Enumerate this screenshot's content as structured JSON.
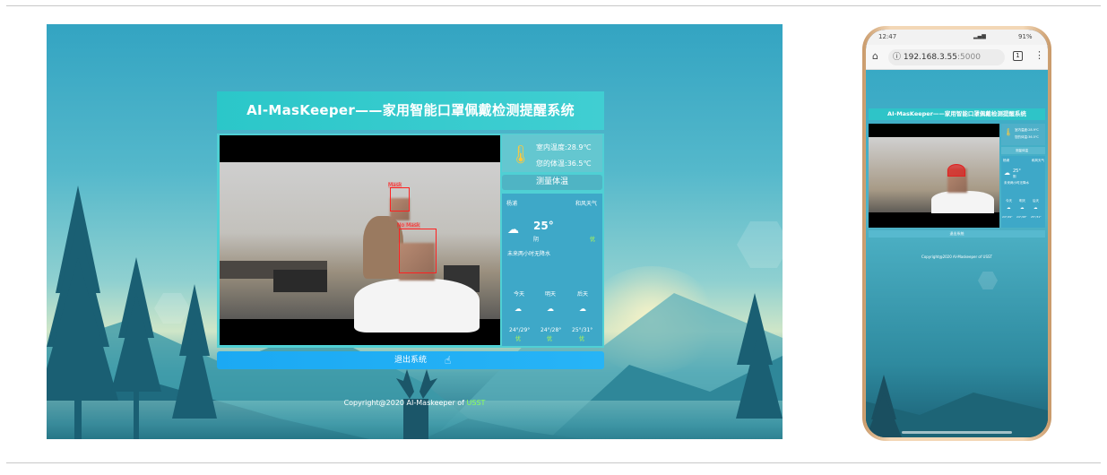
{
  "desktop": {
    "title": "AI-MasKeeper——家用智能口罩佩戴检测提醒系统",
    "temperature": {
      "indoor": "室内温度:28.9℃",
      "body": "您的体温:36.5℃",
      "measure_button": "测量体温"
    },
    "detection_labels": [
      "Mask",
      "No Mask"
    ],
    "weather": {
      "city": "杨浦",
      "header_right": "和风天气",
      "current_temp": "25°",
      "condition": "阴",
      "aqi": "优",
      "forecast_note": "未来两小时无降水",
      "days": [
        {
          "label": "今天",
          "range": "24°/29°",
          "quality": "优"
        },
        {
          "label": "明天",
          "range": "24°/28°",
          "quality": "优"
        },
        {
          "label": "后天",
          "range": "25°/31°",
          "quality": "优"
        }
      ]
    },
    "exit_button": "退出系统",
    "copyright_prefix": "Copyright@2020 AI-Maskeeper of ",
    "copyright_highlight": "USST"
  },
  "phone": {
    "status_time": "12:47",
    "status_right": "91%",
    "url_host": "192.168.3.55",
    "url_port": ":5000",
    "tab_count": "1",
    "title": "AI-MasKeeper——家用智能口罩佩戴检测提醒系统",
    "indoor": "室内温度:28.9℃",
    "body": "您的体温:36.5℃",
    "measure_button": "测量体温",
    "city": "杨浦",
    "header_right": "和风天气",
    "current_temp": "25°",
    "condition": "阴",
    "forecast_note": "未来两小时无降水",
    "day_labels": [
      "今天",
      "明天",
      "后天"
    ],
    "day_ranges": [
      "24°/29°",
      "24°/28°",
      "25°/31°"
    ],
    "exit_button": "退出系统",
    "copyright": "Copyright@2020 AI-Maskeeper of USST"
  },
  "colors": {
    "title_bar": "#2bc7c9",
    "exit_button": "#1ba9f3",
    "detection_box": "#ff2020",
    "highlight_green": "#8bff5a"
  }
}
